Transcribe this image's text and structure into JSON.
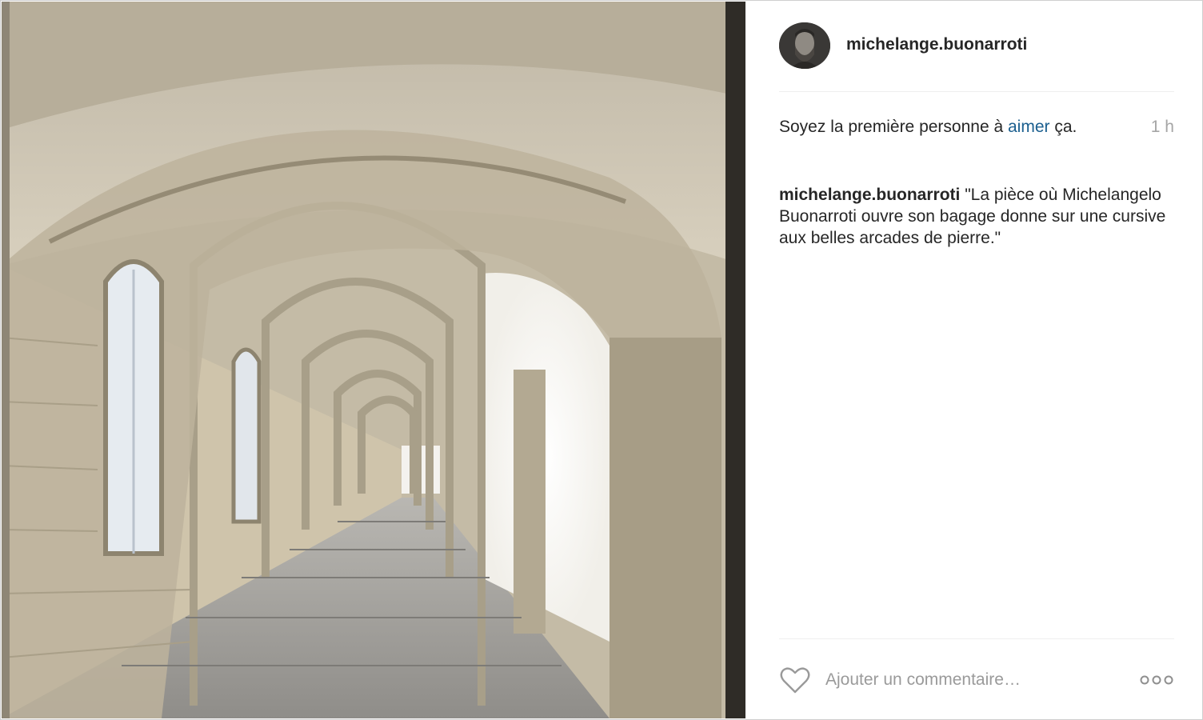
{
  "post": {
    "username": "michelange.buonarroti",
    "likes": {
      "prefix": "Soyez la première personne à ",
      "link": "aimer",
      "suffix": " ça."
    },
    "time": "1 h",
    "caption": {
      "username": "michelange.buonarroti",
      "text": "\"La pièce où Michelangelo Buonarroti ouvre son bagage donne sur une cursive aux belles arcades de pierre.\""
    }
  },
  "comment": {
    "placeholder": "Ajouter un commentaire…"
  },
  "icons": {
    "like": "heart-icon",
    "more": "more-options-icon",
    "avatar": "profile-avatar"
  },
  "colors": {
    "link": "#1b5f8f",
    "muted": "#a5a5a5",
    "text": "#262626"
  }
}
